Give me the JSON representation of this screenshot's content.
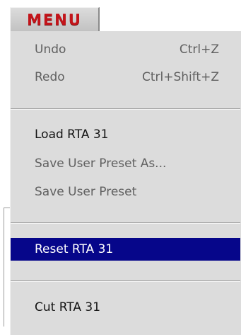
{
  "header": {
    "title": "MENU"
  },
  "menu": {
    "undo": {
      "label": "Undo",
      "shortcut": "Ctrl+Z"
    },
    "redo": {
      "label": "Redo",
      "shortcut": "Ctrl+Shift+Z"
    },
    "load": {
      "label": "Load RTA 31"
    },
    "save_as": {
      "label": "Save User Preset As..."
    },
    "save": {
      "label": "Save User Preset"
    },
    "reset": {
      "label": "Reset RTA 31"
    },
    "cut": {
      "label": "Cut RTA 31"
    }
  },
  "colors": {
    "accent": "#c4141a",
    "selection": "#06068a",
    "panel": "#dcdcdc"
  }
}
